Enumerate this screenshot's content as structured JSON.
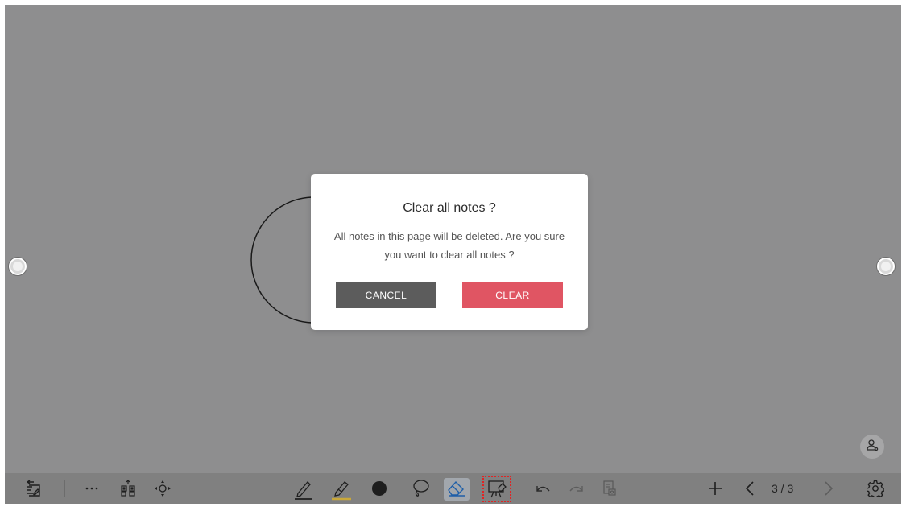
{
  "dialog": {
    "title": "Clear all notes ?",
    "message": "All notes in this page will be deleted. Are you sure you want to clear all notes ?",
    "cancel_label": "CANCEL",
    "clear_label": "CLEAR"
  },
  "colors": {
    "canvas": "#8e8e8f",
    "toolbar": "#808080",
    "cancel_button": "#5c5c5c",
    "clear_button": "#e05563",
    "highlighter_accent": "#c9a83a",
    "selected_tool_highlight": "#a2a7ad",
    "dashed_outline": "#e02424"
  },
  "toolbar": {
    "left_icons": [
      "menu-list-icon",
      "more-dots-icon",
      "qr-scan-icon",
      "move-arrows-icon"
    ],
    "center_icons": [
      "pen-icon",
      "highlighter-icon",
      "brush-dot-icon",
      "lasso-icon",
      "eraser-icon",
      "clear-board-icon",
      "undo-icon",
      "redo-icon",
      "save-page-icon"
    ],
    "right_icons": [
      "add-page-icon",
      "prev-page-icon",
      "next-page-icon",
      "settings-icon"
    ],
    "page_indicator": "3 / 3",
    "selected_tool": "eraser-icon"
  },
  "canvas": {
    "user_icon": "user-icon",
    "side_handles": [
      "left-handle",
      "right-handle"
    ]
  }
}
